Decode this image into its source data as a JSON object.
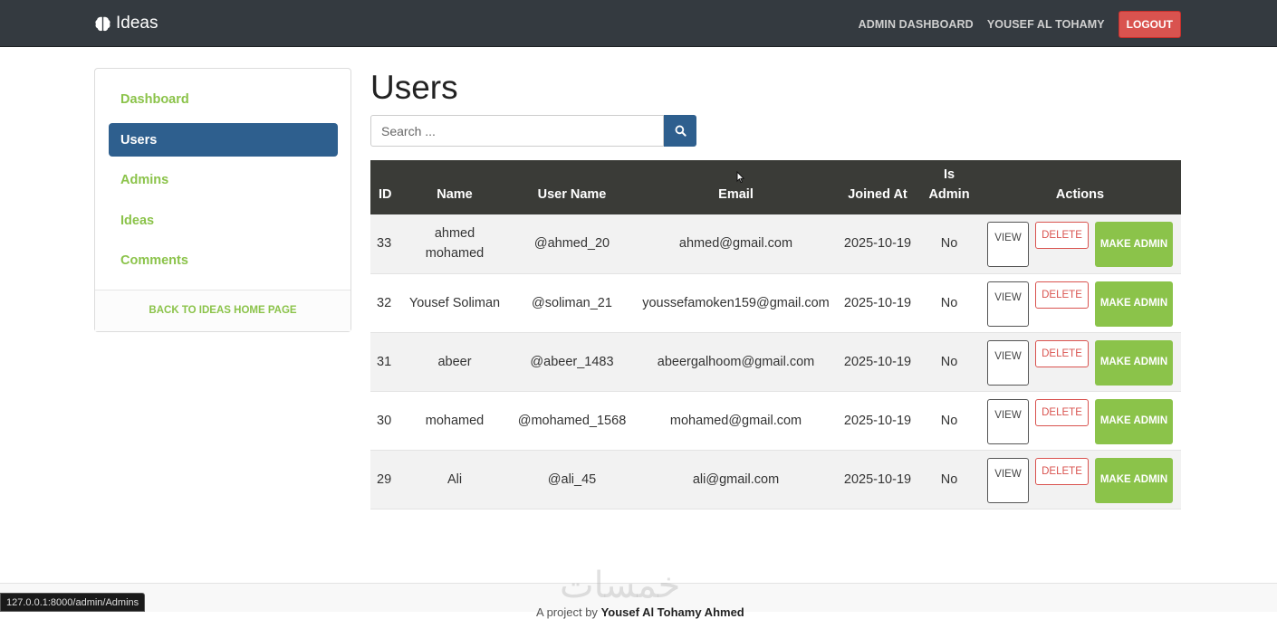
{
  "navbar": {
    "brand": "Ideas",
    "brand_icon": "brain-icon",
    "links": [
      "ADMIN DASHBOARD",
      "YOUSEF AL TOHAMY"
    ],
    "logout_label": "LOGOUT"
  },
  "sidebar": {
    "items": [
      {
        "label": "Dashboard",
        "active": false
      },
      {
        "label": "Users",
        "active": true
      },
      {
        "label": "Admins",
        "active": false
      },
      {
        "label": "Ideas",
        "active": false
      },
      {
        "label": "Comments",
        "active": false
      }
    ],
    "footer_link": "BACK TO IDEAS HOME PAGE"
  },
  "main": {
    "title": "Users",
    "search": {
      "placeholder": "Search ...",
      "value": "",
      "icon": "search-icon"
    },
    "table": {
      "headers": {
        "id": "ID",
        "name": "Name",
        "username": "User Name",
        "email": "Email",
        "joined": "Joined At",
        "is_admin_line1": "Is",
        "is_admin_line2": "Admin",
        "actions": "Actions"
      },
      "rows": [
        {
          "id": "33",
          "name": "ahmed mohamed",
          "username": "@ahmed_20",
          "email": "ahmed@gmail.com",
          "joined": "2025-10-19",
          "is_admin": "No"
        },
        {
          "id": "32",
          "name": "Yousef Soliman",
          "username": "@soliman_21",
          "email": "youssefamoken159@gmail.com",
          "joined": "2025-10-19",
          "is_admin": "No"
        },
        {
          "id": "31",
          "name": "abeer",
          "username": "@abeer_1483",
          "email": "abeergalhoom@gmail.com",
          "joined": "2025-10-19",
          "is_admin": "No"
        },
        {
          "id": "30",
          "name": "mohamed",
          "username": "@mohamed_1568",
          "email": "mohamed@gmail.com",
          "joined": "2025-10-19",
          "is_admin": "No"
        },
        {
          "id": "29",
          "name": "Ali",
          "username": "@ali_45",
          "email": "ali@gmail.com",
          "joined": "2025-10-19",
          "is_admin": "No"
        }
      ],
      "action_labels": {
        "view": "VIEW",
        "delete": "DELETE",
        "make_admin": "MAKE ADMIN"
      }
    }
  },
  "footer": {
    "prefix": "A project by",
    "author": "Yousef Al Tohamy Ahmed",
    "watermark": "خمسات"
  },
  "status_bar": {
    "url": "127.0.0.1:8000/admin/Admins"
  },
  "colors": {
    "navbar": "#343a40",
    "accent_green": "#8bc34a",
    "active_blue": "#2e5f8e",
    "danger_red": "#d9534f",
    "table_header": "#3a3b37"
  }
}
